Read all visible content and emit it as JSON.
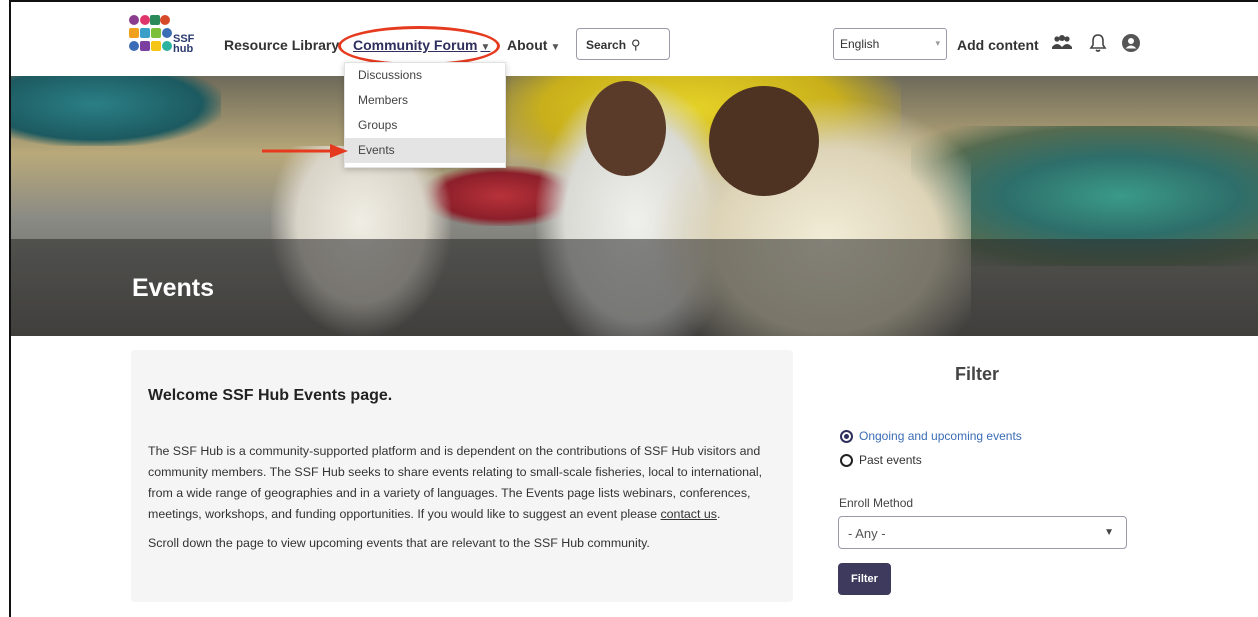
{
  "header": {
    "logo_text_line1": "SSF",
    "logo_text_line2": "hub",
    "nav": {
      "resource_library": "Resource Library",
      "community_forum": "Community Forum",
      "about": "About"
    },
    "search_label": "Search",
    "language": "English",
    "add_content": "Add content",
    "icons": [
      "users-icon",
      "bell-icon",
      "user-account-icon"
    ]
  },
  "dropdown": {
    "items": [
      {
        "label": "Discussions"
      },
      {
        "label": "Members"
      },
      {
        "label": "Groups"
      },
      {
        "label": "Events",
        "active": true
      }
    ]
  },
  "hero": {
    "title": "Events"
  },
  "welcome": {
    "heading": "Welcome SSF Hub Events page.",
    "para1_pre": "The SSF Hub is a community-supported platform and is dependent on the contributions of SSF Hub visitors and community members. The SSF Hub seeks to share events relating to small-scale fisheries, local to international, from a wide range of geographies and in a variety of languages. The Events page lists webinars, conferences, meetings, workshops, and funding opportunities. If you would like to suggest an event please ",
    "contact_link": "contact us",
    "para1_post": ".",
    "para2": "Scroll down the page to view upcoming events that are relevant to the SSF Hub community."
  },
  "filter": {
    "title": "Filter",
    "options": [
      {
        "label": "Ongoing and upcoming events",
        "selected": true
      },
      {
        "label": "Past events",
        "selected": false
      }
    ],
    "enroll_label": "Enroll Method",
    "enroll_value": "- Any -",
    "button": "Filter"
  },
  "colors": {
    "accent": "#3d3a5e",
    "annotation": "#e63a1f",
    "selected_radio_text": "#3a6db5"
  }
}
